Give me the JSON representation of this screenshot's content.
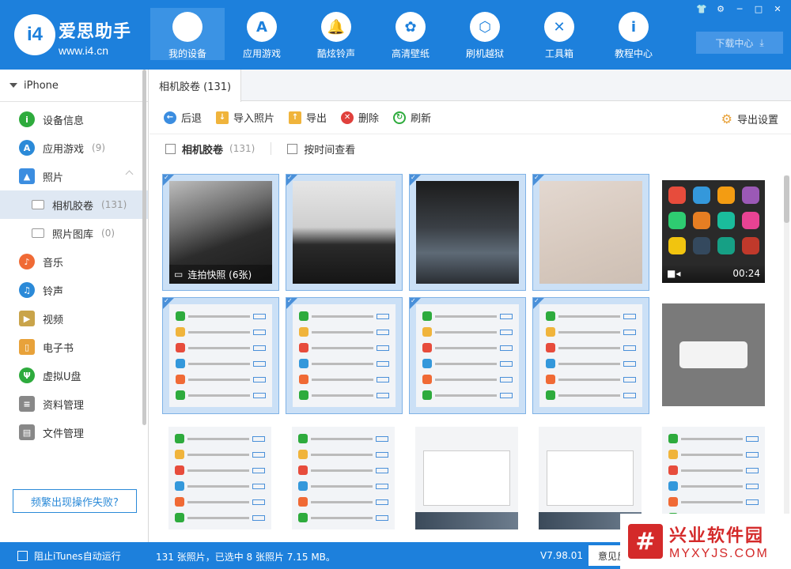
{
  "brand": {
    "logo_text": "i4",
    "name": "爱思助手",
    "url": "www.i4.cn"
  },
  "nav": {
    "items": [
      {
        "label": "我的设备",
        "icon": "apple-icon"
      },
      {
        "label": "应用游戏",
        "icon": "appstore-icon"
      },
      {
        "label": "酷炫铃声",
        "icon": "bell-icon"
      },
      {
        "label": "高清壁纸",
        "icon": "flower-icon"
      },
      {
        "label": "刷机越狱",
        "icon": "box-icon"
      },
      {
        "label": "工具箱",
        "icon": "tools-icon"
      },
      {
        "label": "教程中心",
        "icon": "info-icon"
      }
    ],
    "active_index": 0
  },
  "download_center": "下载中心",
  "sidebar": {
    "device": "iPhone",
    "items": [
      {
        "label": "设备信息",
        "count": "",
        "icon": "info-icon",
        "color": "#2eab3d"
      },
      {
        "label": "应用游戏",
        "count": "(9)",
        "icon": "appstore-icon",
        "color": "#2b8ad8"
      },
      {
        "label": "照片",
        "count": "",
        "icon": "photo-icon",
        "color": "#3b8de0"
      },
      {
        "label": "相机胶卷",
        "count": "(131)",
        "icon": "camera-roll-icon",
        "color": "#999999"
      },
      {
        "label": "照片图库",
        "count": "(0)",
        "icon": "folder-icon",
        "color": "#999999"
      },
      {
        "label": "音乐",
        "count": "",
        "icon": "music-icon",
        "color": "#f06a35"
      },
      {
        "label": "铃声",
        "count": "",
        "icon": "bell-icon",
        "color": "#2b8ad8"
      },
      {
        "label": "视频",
        "count": "",
        "icon": "film-icon",
        "color": "#c9a44a"
      },
      {
        "label": "电子书",
        "count": "",
        "icon": "book-icon",
        "color": "#e8a23a"
      },
      {
        "label": "虚拟U盘",
        "count": "",
        "icon": "usb-icon",
        "color": "#2eab3d"
      },
      {
        "label": "资料管理",
        "count": "",
        "icon": "contacts-icon",
        "color": "#888888"
      },
      {
        "label": "文件管理",
        "count": "",
        "icon": "files-icon",
        "color": "#888888"
      }
    ],
    "help_button": "频繁出现操作失败?"
  },
  "main": {
    "tab": "相机胶卷 (131)",
    "toolbar": {
      "back": "后退",
      "import": "导入照片",
      "export": "导出",
      "delete": "删除",
      "refresh": "刷新",
      "export_settings": "导出设置"
    },
    "filter": {
      "album_label": "相机胶卷",
      "album_count": "(131)",
      "by_time": "按时间查看"
    },
    "photos": [
      {
        "kind": "keyboard",
        "selected": true,
        "overlay": "连拍快照 (6张)"
      },
      {
        "kind": "laptop",
        "selected": true,
        "overlay": ""
      },
      {
        "kind": "keyboard-dark",
        "selected": true,
        "overlay": ""
      },
      {
        "kind": "blur",
        "selected": true,
        "overlay": ""
      },
      {
        "kind": "video",
        "selected": false,
        "overlay": "00:24"
      },
      {
        "kind": "appstore",
        "selected": true,
        "overlay": ""
      },
      {
        "kind": "appstore",
        "selected": true,
        "overlay": ""
      },
      {
        "kind": "applist",
        "selected": true,
        "overlay": ""
      },
      {
        "kind": "applist",
        "selected": true,
        "overlay": ""
      },
      {
        "kind": "dialog",
        "selected": false,
        "overlay": ""
      },
      {
        "kind": "applist",
        "selected": false,
        "overlay": ""
      },
      {
        "kind": "applist",
        "selected": false,
        "overlay": ""
      },
      {
        "kind": "desktop",
        "selected": false,
        "overlay": ""
      },
      {
        "kind": "desktop",
        "selected": false,
        "overlay": ""
      },
      {
        "kind": "applist",
        "selected": false,
        "overlay": ""
      }
    ]
  },
  "status": {
    "block_itunes": "阻止iTunes自动运行",
    "summary": "131 张照片，已选中 8 张照片 7.15 MB。",
    "version": "V7.98.01",
    "feedback": "意见反"
  },
  "watermark": {
    "logo": "#",
    "line1": "兴业软件园",
    "line2": "MYXYJS.COM"
  },
  "colors": {
    "primary": "#1d80dc",
    "selected_bg": "#cbe0f6"
  }
}
